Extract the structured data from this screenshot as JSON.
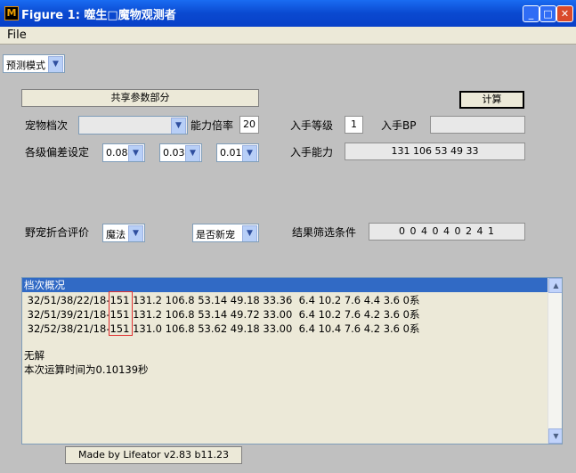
{
  "window": {
    "title": "Figure 1: 噬生□魔物观测者",
    "icon": "matlab-icon",
    "minimize_glyph": "_",
    "maximize_glyph": "□",
    "close_glyph": "✕"
  },
  "menubar": {
    "file_label": "File"
  },
  "mode_select": {
    "value": "预测模式"
  },
  "shared_params_button": "共享参数部分",
  "compute_button": "计算",
  "row1": {
    "pet_tier_label": "宠物档次",
    "pet_tier_value": "",
    "ability_multiplier_label": "能力倍率",
    "ability_multiplier_value": "20",
    "obtain_level_label": "入手等级",
    "obtain_level_value": "1",
    "obtain_bp_label": "入手BP",
    "obtain_bp_value": ""
  },
  "row2": {
    "deviation_label": "各级偏差设定",
    "dev1": "0.08",
    "dev2": "0.03",
    "dev3": "0.01",
    "obtain_ability_label": "入手能力",
    "obtain_ability_value": "131 106 53 49 33"
  },
  "row3": {
    "wild_rating_label": "野宠折合评价",
    "wild_rating_value": "魔法",
    "is_new_value": "是否新宠",
    "filter_label": "结果筛选条件",
    "filter_value": "0 0 4 0 4 0 2 4 1"
  },
  "results": {
    "header": "档次概况",
    "lines": [
      " 32/51/38/22/18-151 131.2 106.8 53.14 49.18 33.36  6.4 10.2 7.6 4.4 3.6 0系",
      " 32/51/39/21/18-151 131.2 106.8 53.14 49.72 33.00  6.4 10.2 7.6 4.2 3.6 0系",
      " 32/52/38/21/18-151 131.0 106.8 53.62 49.18 33.00  6.4 10.4 7.6 4.2 3.6 0系",
      "",
      "无解",
      "本次运算时间为0.10139秒"
    ]
  },
  "footer": {
    "credit": "Made by Lifeator   v2.83 b11.23"
  }
}
